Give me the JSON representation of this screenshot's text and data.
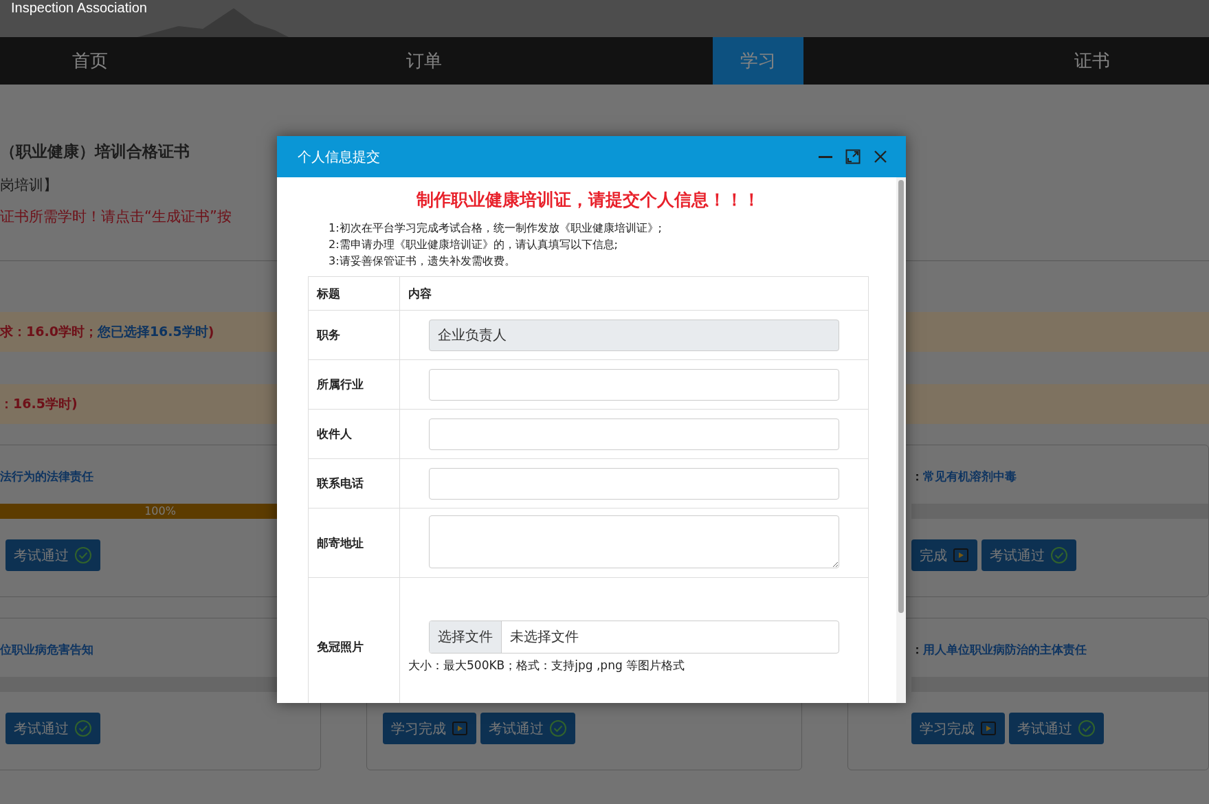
{
  "header": {
    "org_name": "Inspection  Association"
  },
  "nav": [
    {
      "label": "首页",
      "selected": false
    },
    {
      "label": "订单",
      "selected": false
    },
    {
      "label": "学习",
      "selected": true
    },
    {
      "label": "证书",
      "selected": false
    }
  ],
  "certificate": {
    "title": "（职业健康）培训合格证书",
    "subtitle": "岗培训】",
    "notice": "证书所需学时！请点击“生成证书”按"
  },
  "hour_bands": [
    {
      "parts": [
        {
          "text": "求：16.0学时；",
          "kind": "plain"
        },
        {
          "text": "您已选择16.5学时",
          "kind": "emphasis"
        },
        {
          "text": ")",
          "kind": "plain"
        }
      ]
    },
    {
      "parts": [
        {
          "text": "：16.5学时)",
          "kind": "plain"
        }
      ]
    }
  ],
  "columns": [
    {
      "cards": [
        {
          "title": "法行为的法律责任",
          "progress": {
            "level": 1,
            "text": "100%"
          },
          "buttons": [
            {
              "kind": "exam",
              "label": "考试通过"
            }
          ]
        },
        {
          "title": "位职业病危害告知",
          "progress": {
            "level": 0
          },
          "buttons": [
            {
              "kind": "exam",
              "label": "考试通过"
            }
          ]
        }
      ]
    },
    {
      "cards": [
        {
          "buttons": [
            {
              "kind": "study",
              "label": "学习完成"
            },
            {
              "kind": "exam",
              "label": "考试通过"
            }
          ]
        }
      ]
    },
    {
      "cards": [
        {
          "label": "：",
          "title": "常见有机溶剂中毒",
          "progress": {
            "level": 0
          },
          "buttons": [
            {
              "kind": "study",
              "label": "完成"
            },
            {
              "kind": "exam",
              "label": "考试通过"
            }
          ]
        },
        {
          "label": "：",
          "title": "用人单位职业病防治的主体责任",
          "progress": {
            "level": 0
          },
          "buttons": [
            {
              "kind": "study",
              "label": "学习完成"
            },
            {
              "kind": "exam",
              "label": "考试通过"
            }
          ]
        }
      ]
    }
  ],
  "dialog": {
    "title": "个人信息提交",
    "heading": "制作职业健康培训证，请提交个人信息！！！",
    "notes": [
      "1:初次在平台学习完成考试合格，统一制作发放《职业健康培训证》;",
      "2:需申请办理《职业健康培训证》的，请认真填写以下信息;",
      "3:请妥善保管证书，遗失补发需收费。"
    ],
    "columns": [
      "标题",
      "内容"
    ],
    "fields": [
      {
        "label": "职务",
        "kind": "text",
        "value": "企业负责人",
        "disabled": true
      },
      {
        "label": "所属行业",
        "kind": "text",
        "disabled": false
      },
      {
        "label": "收件人",
        "kind": "text",
        "disabled": false
      },
      {
        "label": "联系电话",
        "kind": "text",
        "disabled": false
      },
      {
        "label": "邮寄地址",
        "kind": "textarea",
        "disabled": false
      },
      {
        "label": "免冠照片",
        "kind": "file",
        "button": "选择文件",
        "status": "未选择文件",
        "hint": "大小：最大500KB；格式：支持jpg ,png 等图片格式"
      }
    ]
  }
}
